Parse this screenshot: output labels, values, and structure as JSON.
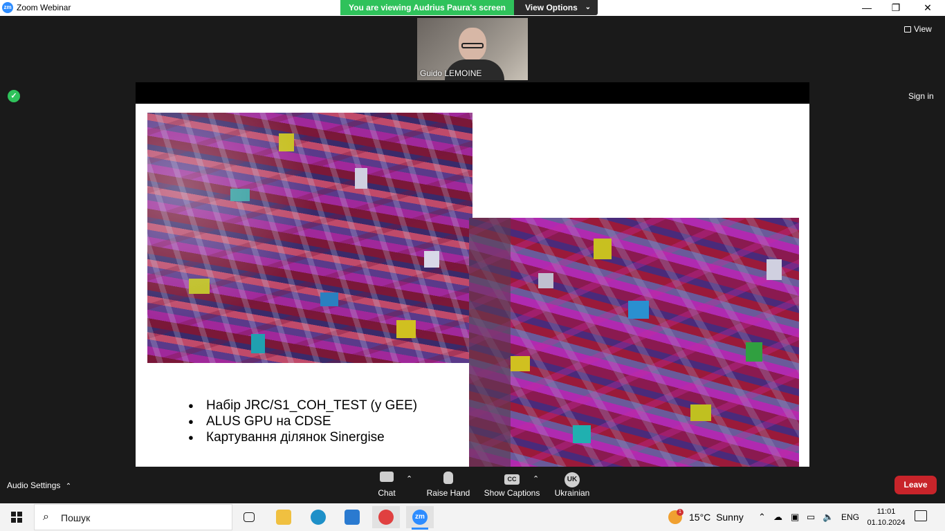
{
  "window": {
    "app_title": "Zoom Webinar",
    "app_logo_text": "zm",
    "viewing_banner": "You are viewing Audrius Paura's screen",
    "view_options_label": "View Options",
    "minimize": "—",
    "restore": "❐",
    "close": "✕"
  },
  "meeting": {
    "speaker_name": "Guido LEMOINE",
    "view_label": "View",
    "sign_in_label": "Sign in"
  },
  "slide": {
    "bullets": [
      "Набір JRC/S1_COH_TEST (у GEE)",
      "ALUS GPU на CDSE",
      "Картування ділянок Sinergise"
    ]
  },
  "controls": {
    "audio_settings_label": "Audio Settings",
    "chat_label": "Chat",
    "raise_hand_label": "Raise Hand",
    "show_captions_label": "Show Captions",
    "captions_icon_text": "CC",
    "language_label": "Ukrainian",
    "language_icon_text": "UK",
    "leave_label": "Leave"
  },
  "taskbar": {
    "search_placeholder": "Пошук",
    "weather_temp": "15°C",
    "weather_condition": "Sunny",
    "weather_badge": "1",
    "language": "ENG",
    "time": "11:01",
    "date": "01.10.2024",
    "zoom_app_text": "zm"
  }
}
